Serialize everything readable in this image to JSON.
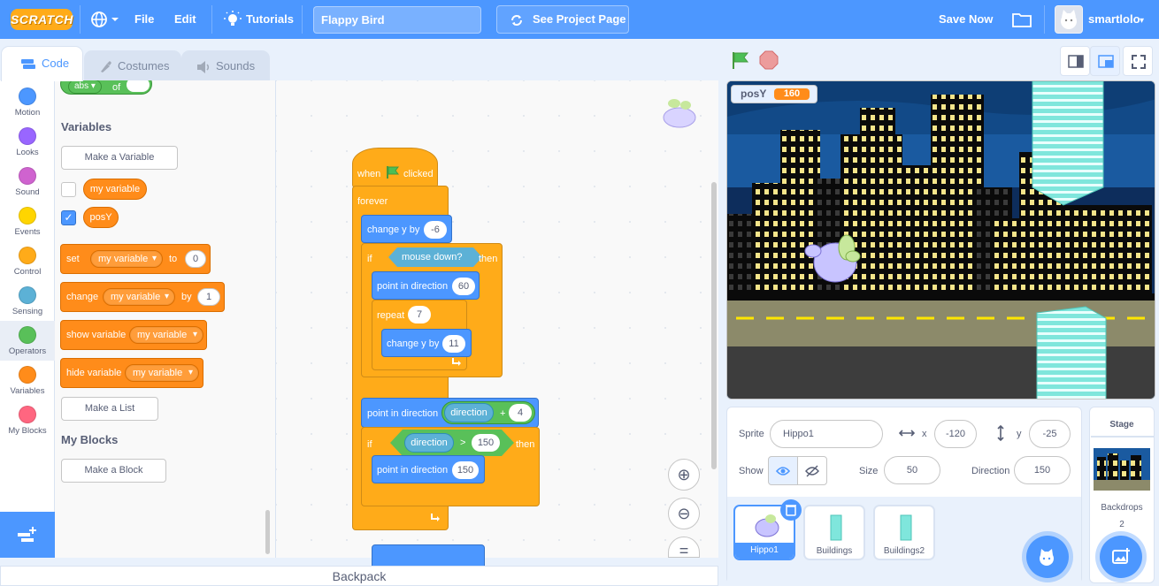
{
  "menu": {
    "logo": "SCRATCH",
    "file": "File",
    "edit": "Edit",
    "tutorials": "Tutorials",
    "project_title": "Flappy Bird",
    "see_project": "See Project Page",
    "save_now": "Save Now",
    "username": "smartlolo"
  },
  "tabs": {
    "code": "Code",
    "costumes": "Costumes",
    "sounds": "Sounds"
  },
  "categories": [
    {
      "label": "Motion",
      "color": "#4c97ff"
    },
    {
      "label": "Looks",
      "color": "#9966ff"
    },
    {
      "label": "Sound",
      "color": "#cf63cf"
    },
    {
      "label": "Events",
      "color": "#ffd500"
    },
    {
      "label": "Control",
      "color": "#ffab19"
    },
    {
      "label": "Sensing",
      "color": "#5cb1d6"
    },
    {
      "label": "Operators",
      "color": "#59c059"
    },
    {
      "label": "Variables",
      "color": "#ff8c1a"
    },
    {
      "label": "My Blocks",
      "color": "#ff6680"
    }
  ],
  "palette": {
    "abs_block": {
      "op": "abs",
      "of": "of"
    },
    "variables_title": "Variables",
    "make_variable": "Make a Variable",
    "var1": "my variable",
    "var2": "posY",
    "set_block": {
      "set": "set",
      "var": "my variable",
      "to": "to",
      "value": "0"
    },
    "change_block": {
      "change": "change",
      "var": "my variable",
      "by": "by",
      "value": "1"
    },
    "show_block": {
      "label": "show variable",
      "var": "my variable"
    },
    "hide_block": {
      "label": "hide variable",
      "var": "my variable"
    },
    "make_list": "Make a List",
    "myblocks_title": "My Blocks",
    "make_block": "Make a Block"
  },
  "script": {
    "hat": {
      "when": "when",
      "clicked": "clicked"
    },
    "forever": "forever",
    "change_y1": {
      "label": "change y by",
      "value": "-6"
    },
    "if1": {
      "if": "if",
      "cond": "mouse down?",
      "then": "then"
    },
    "point1": {
      "label": "point in direction",
      "value": "60"
    },
    "repeat": {
      "label": "repeat",
      "value": "7"
    },
    "change_y2": {
      "label": "change y by",
      "value": "11"
    },
    "point2": {
      "label": "point in direction",
      "reporter": "direction",
      "op": "+",
      "value": "4"
    },
    "if2": {
      "if": "if",
      "reporter": "direction",
      "op": ">",
      "value": "150",
      "then": "then"
    },
    "point3": {
      "label": "point in direction",
      "value": "150"
    }
  },
  "backpack": "Backpack",
  "monitor": {
    "name": "posY",
    "value": "160"
  },
  "sprite_info": {
    "sprite_label": "Sprite",
    "sprite_name": "Hippo1",
    "x_label": "x",
    "x_value": "-120",
    "y_label": "y",
    "y_value": "-25",
    "show_label": "Show",
    "size_label": "Size",
    "size_value": "50",
    "direction_label": "Direction",
    "direction_value": "150"
  },
  "sprites": [
    "Hippo1",
    "Buildings",
    "Buildings2"
  ],
  "stage_pane": {
    "title": "Stage",
    "backdrops_label": "Backdrops",
    "backdrops_count": "2"
  }
}
